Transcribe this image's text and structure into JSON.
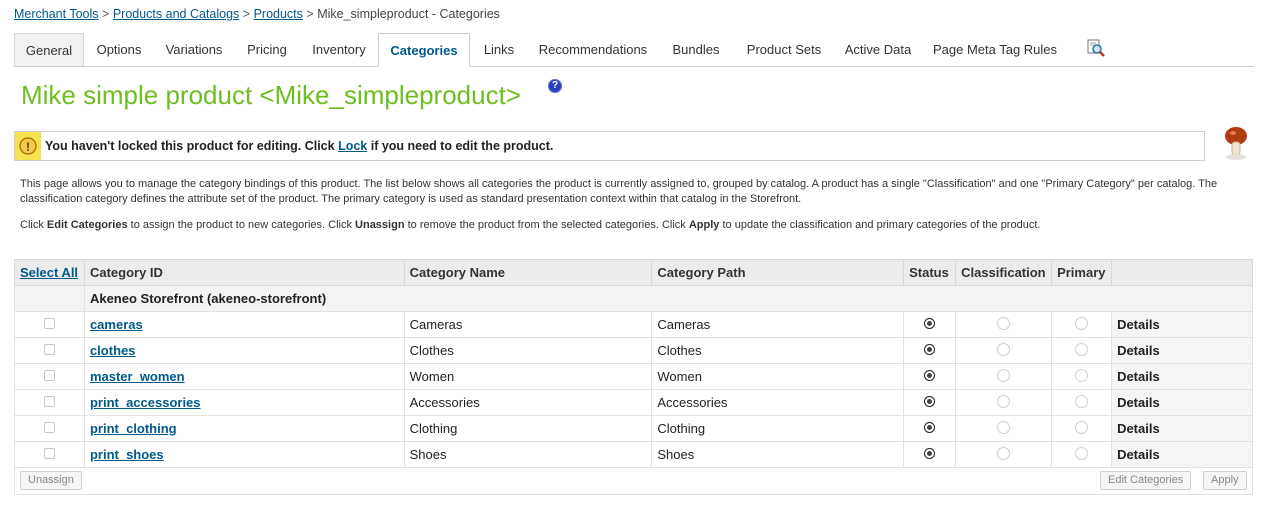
{
  "breadcrumb": {
    "items": [
      "Merchant Tools",
      "Products and Catalogs",
      "Products"
    ],
    "separator": ">",
    "current": "Mike_simpleproduct - Categories"
  },
  "tabs": [
    "General",
    "Options",
    "Variations",
    "Pricing",
    "Inventory",
    "Categories",
    "Links",
    "Recommendations",
    "Bundles",
    "Product Sets",
    "Active Data",
    "Page Meta Tag Rules"
  ],
  "active_tab": "Categories",
  "title": "Mike simple product <Mike_simpleproduct>",
  "help_icon_glyph": "?",
  "warning": {
    "before": "You haven't locked this product for editing. Click ",
    "link": "Lock",
    "after": " if you need to edit the product."
  },
  "description": "This page allows you to manage the category bindings of this product. The list below shows all categories the product is currently assigned to, grouped by catalog. A product has a single \"Classification\" and one \"Primary Category\" per catalog. The classification category defines the attribute set of the product. The primary category is used as standard presentation context within that catalog in the Storefront.",
  "instructions": {
    "p1": "Click ",
    "b1": "Edit Categories",
    "p2": " to assign the product to new categories. Click ",
    "b2": "Unassign",
    "p3": " to remove the product from the selected categories. Click ",
    "b3": "Apply",
    "p4": " to update the classification and primary categories of the product."
  },
  "table": {
    "select_all": "Select All",
    "headers": [
      "Category ID",
      "Category Name",
      "Category Path",
      "Status",
      "Classification",
      "Primary"
    ],
    "group": "Akeneo Storefront (akeneo-storefront)",
    "details_label": "Details",
    "rows": [
      {
        "id": "cameras",
        "name": "Cameras",
        "path": "Cameras"
      },
      {
        "id": "clothes",
        "name": "Clothes",
        "path": "Clothes"
      },
      {
        "id": "master_women",
        "name": "Women",
        "path": "Women"
      },
      {
        "id": "print_accessories",
        "name": "Accessories",
        "path": "Accessories"
      },
      {
        "id": "print_clothing",
        "name": "Clothing",
        "path": "Clothing"
      },
      {
        "id": "print_shoes",
        "name": "Shoes",
        "path": "Shoes"
      }
    ]
  },
  "buttons": {
    "unassign": "Unassign",
    "edit_categories": "Edit Categories",
    "apply": "Apply"
  },
  "colors": {
    "title": "#6dbe1f",
    "link": "#00598a",
    "warning_bg": "#f4e24e"
  }
}
